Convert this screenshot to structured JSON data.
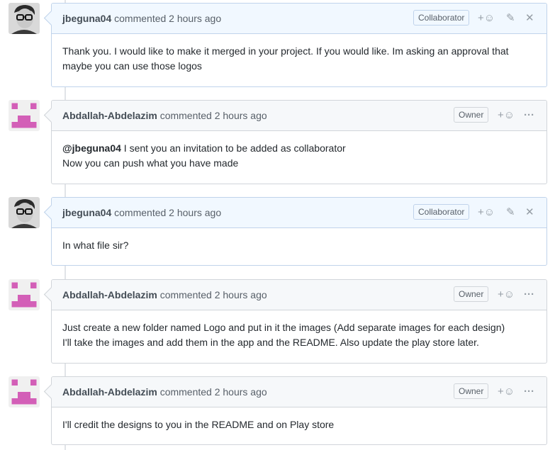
{
  "comments": [
    {
      "author": "jbeguna04",
      "meta": "commented 2 hours ago",
      "badge": "Collaborator",
      "actions": [
        "add-reaction",
        "edit",
        "delete"
      ],
      "lines": [
        "Thank you. I would like to make it merged in your project. If you would like. Im asking an approval that",
        "maybe you can use those logos"
      ]
    },
    {
      "author": "Abdallah-Abdelazim",
      "meta": "commented 2 hours ago",
      "badge": "Owner",
      "actions": [
        "add-reaction",
        "more"
      ],
      "mention": "@jbeguna04",
      "lines": [
        " I sent you an invitation to be added as collaborator",
        "Now you can push what you have made"
      ]
    },
    {
      "author": "jbeguna04",
      "meta": "commented 2 hours ago",
      "badge": "Collaborator",
      "actions": [
        "add-reaction",
        "edit",
        "delete"
      ],
      "lines": [
        "In what file sir?"
      ]
    },
    {
      "author": "Abdallah-Abdelazim",
      "meta": "commented 2 hours ago",
      "badge": "Owner",
      "actions": [
        "add-reaction",
        "more"
      ],
      "lines": [
        "Just create a new folder named Logo and put in it the images (Add separate images for each design)",
        "I'll take the images and add them in the app and the README. Also update the play store later."
      ]
    },
    {
      "author": "Abdallah-Abdelazim",
      "meta": "commented 2 hours ago",
      "badge": "Owner",
      "actions": [
        "add-reaction",
        "more"
      ],
      "lines": [
        "I'll credit the designs to you in the README and on Play store"
      ]
    }
  ],
  "icons": {
    "reaction": "+☺",
    "edit": "✎",
    "delete": "✕",
    "more": "···"
  },
  "colors": {
    "collaborator_header": "#f1f8ff",
    "owner_header": "#f6f8fa",
    "identicon": "#d35fb7"
  }
}
